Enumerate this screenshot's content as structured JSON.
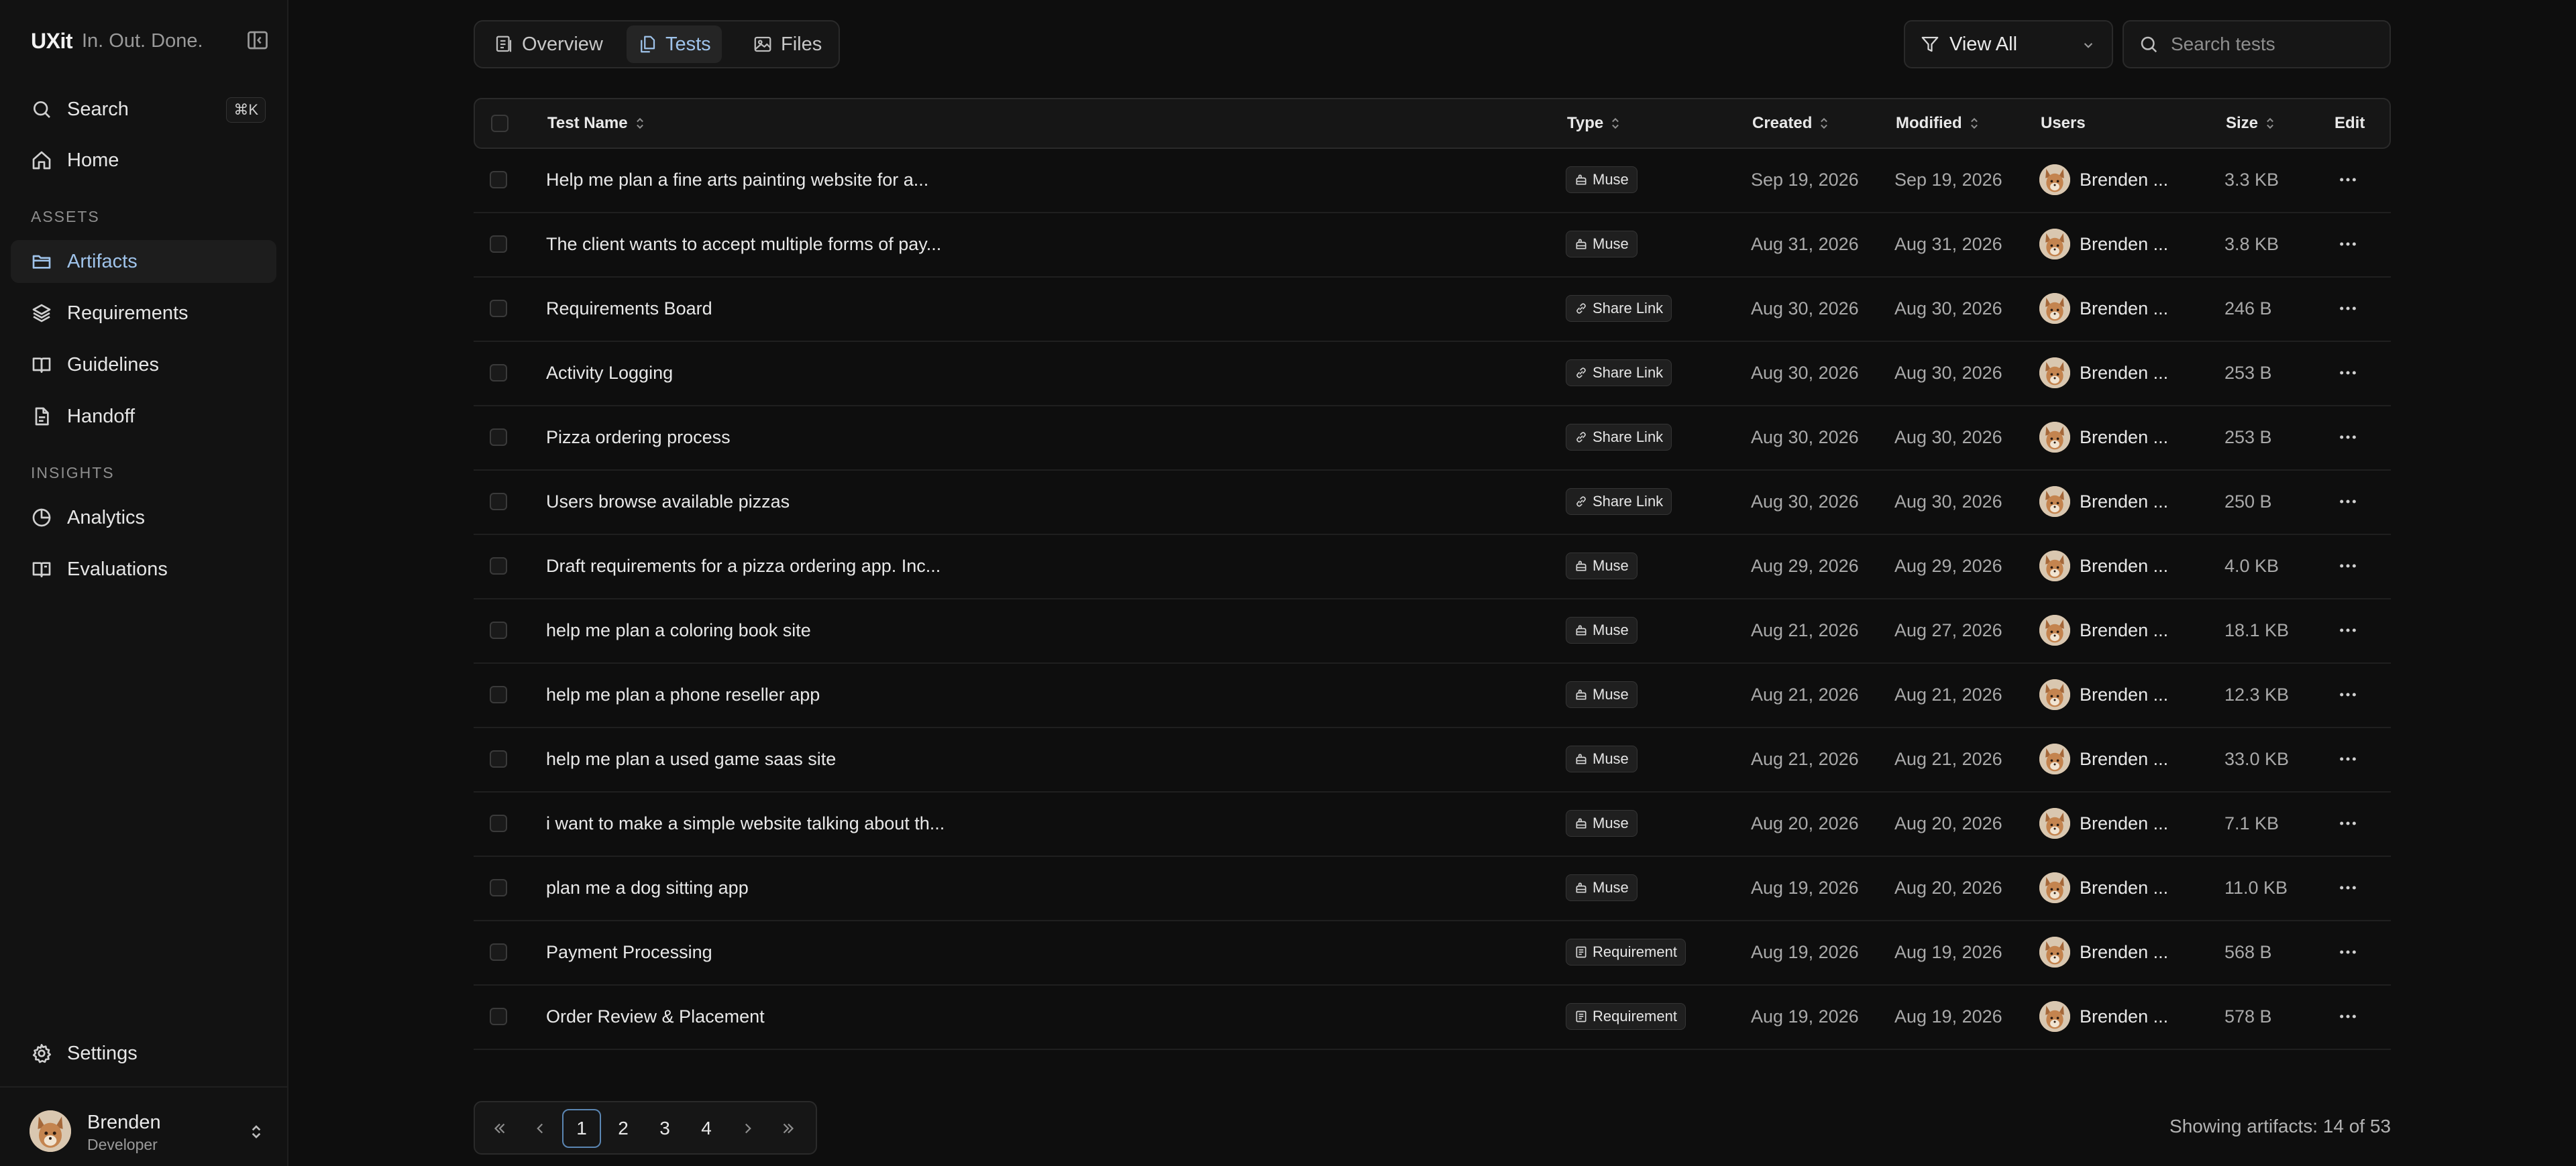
{
  "sidebar": {
    "brand": "UXit",
    "tagline": "In. Out. Done.",
    "search_label": "Search",
    "search_shortcut": "⌘K",
    "home_label": "Home",
    "assets_heading": "ASSETS",
    "assets": [
      {
        "label": "Artifacts",
        "icon": "folder-icon",
        "active": true
      },
      {
        "label": "Requirements",
        "icon": "layers-icon"
      },
      {
        "label": "Guidelines",
        "icon": "book-icon"
      },
      {
        "label": "Handoff",
        "icon": "file-icon"
      }
    ],
    "insights_heading": "INSIGHTS",
    "insights": [
      {
        "label": "Analytics",
        "icon": "pie-chart-icon"
      },
      {
        "label": "Evaluations",
        "icon": "book-open-icon"
      }
    ],
    "settings_label": "Settings",
    "user": {
      "name": "Brenden",
      "role": "Developer"
    }
  },
  "tabs": [
    {
      "label": "Overview",
      "icon": "overview-icon"
    },
    {
      "label": "Tests",
      "icon": "copy-icon",
      "active": true
    },
    {
      "label": "Files",
      "icon": "image-icon"
    }
  ],
  "filter": {
    "label": "View All"
  },
  "search": {
    "placeholder": "Search tests"
  },
  "table": {
    "headers": {
      "name": "Test Name",
      "type": "Type",
      "created": "Created",
      "modified": "Modified",
      "users": "Users",
      "size": "Size",
      "edit": "Edit"
    },
    "rows": [
      {
        "name": "Help me plan a fine arts painting website for a...",
        "type": "Muse",
        "type_icon": "muse-icon",
        "created": "Sep 19, 2026",
        "modified": "Sep 19, 2026",
        "user": "Brenden ...",
        "size": "3.3 KB"
      },
      {
        "name": "The client wants to accept multiple forms of pay...",
        "type": "Muse",
        "type_icon": "muse-icon",
        "created": "Aug 31, 2026",
        "modified": "Aug 31, 2026",
        "user": "Brenden ...",
        "size": "3.8 KB"
      },
      {
        "name": "Requirements Board",
        "type": "Share Link",
        "type_icon": "link-icon",
        "created": "Aug 30, 2026",
        "modified": "Aug 30, 2026",
        "user": "Brenden ...",
        "size": "246 B"
      },
      {
        "name": "Activity Logging",
        "type": "Share Link",
        "type_icon": "link-icon",
        "created": "Aug 30, 2026",
        "modified": "Aug 30, 2026",
        "user": "Brenden ...",
        "size": "253 B"
      },
      {
        "name": "Pizza ordering process",
        "type": "Share Link",
        "type_icon": "link-icon",
        "created": "Aug 30, 2026",
        "modified": "Aug 30, 2026",
        "user": "Brenden ...",
        "size": "253 B"
      },
      {
        "name": "Users browse available pizzas",
        "type": "Share Link",
        "type_icon": "link-icon",
        "created": "Aug 30, 2026",
        "modified": "Aug 30, 2026",
        "user": "Brenden ...",
        "size": "250 B"
      },
      {
        "name": "Draft requirements for a pizza ordering app. Inc...",
        "type": "Muse",
        "type_icon": "muse-icon",
        "created": "Aug 29, 2026",
        "modified": "Aug 29, 2026",
        "user": "Brenden ...",
        "size": "4.0 KB"
      },
      {
        "name": "help me plan a coloring book site",
        "type": "Muse",
        "type_icon": "muse-icon",
        "created": "Aug 21, 2026",
        "modified": "Aug 27, 2026",
        "user": "Brenden ...",
        "size": "18.1 KB"
      },
      {
        "name": "help me plan a phone reseller app",
        "type": "Muse",
        "type_icon": "muse-icon",
        "created": "Aug 21, 2026",
        "modified": "Aug 21, 2026",
        "user": "Brenden ...",
        "size": "12.3 KB"
      },
      {
        "name": "help me plan a used game saas site",
        "type": "Muse",
        "type_icon": "muse-icon",
        "created": "Aug 21, 2026",
        "modified": "Aug 21, 2026",
        "user": "Brenden ...",
        "size": "33.0 KB"
      },
      {
        "name": "i want to make a simple website talking about th...",
        "type": "Muse",
        "type_icon": "muse-icon",
        "created": "Aug 20, 2026",
        "modified": "Aug 20, 2026",
        "user": "Brenden ...",
        "size": "7.1 KB"
      },
      {
        "name": "plan me a dog sitting app",
        "type": "Muse",
        "type_icon": "muse-icon",
        "created": "Aug 19, 2026",
        "modified": "Aug 20, 2026",
        "user": "Brenden ...",
        "size": "11.0 KB"
      },
      {
        "name": "Payment Processing",
        "type": "Requirement",
        "type_icon": "requirement-icon",
        "created": "Aug 19, 2026",
        "modified": "Aug 19, 2026",
        "user": "Brenden ...",
        "size": "568 B"
      },
      {
        "name": "Order Review & Placement",
        "type": "Requirement",
        "type_icon": "requirement-icon",
        "created": "Aug 19, 2026",
        "modified": "Aug 19, 2026",
        "user": "Brenden ...",
        "size": "578 B"
      }
    ]
  },
  "pagination": {
    "pages": [
      "1",
      "2",
      "3",
      "4"
    ],
    "current": "1"
  },
  "footer": {
    "showing": "Showing artifacts: 14 of 53"
  },
  "colors": {
    "accent": "#9fc3ea",
    "background": "#0e0e0e",
    "sidebar": "#121212",
    "active_page_border": "#5b86b3"
  }
}
